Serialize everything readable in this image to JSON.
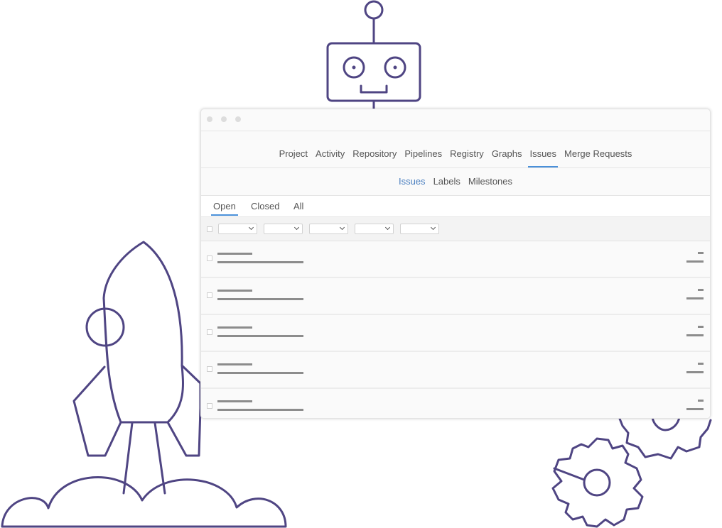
{
  "nav": {
    "items": [
      "Project",
      "Activity",
      "Repository",
      "Pipelines",
      "Registry",
      "Graphs",
      "Issues",
      "Merge Requests"
    ],
    "active": "Issues"
  },
  "subnav": {
    "items": [
      "Issues",
      "Labels",
      "Milestones"
    ],
    "active": "Issues"
  },
  "state_tabs": {
    "items": [
      "Open",
      "Closed",
      "All"
    ],
    "active": "Open"
  },
  "filter_dropdown_count": 5,
  "issue_row_count": 5,
  "colors": {
    "illustration_stroke": "#4f4583",
    "active_tab_underline": "#4a90d9",
    "active_subnav_text": "#4a7fbf"
  },
  "icons": [
    "robot-illustration",
    "rocket-illustration",
    "gears-illustration",
    "chevron-down-icon",
    "checkbox-icon"
  ]
}
